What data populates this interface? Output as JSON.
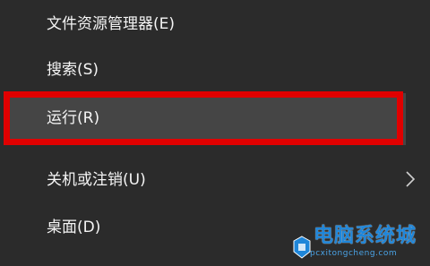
{
  "menu": {
    "items": [
      {
        "label": "文件资源管理器(E)"
      },
      {
        "label": "搜索(S)"
      },
      {
        "label": "运行(R)"
      },
      {
        "label": "关机或注销(U)"
      },
      {
        "label": "桌面(D)"
      }
    ]
  },
  "highlight": {
    "color": "#e00000"
  },
  "watermark": {
    "text_cn": "电脑系统城",
    "text_en": "pcxitongcheng.com"
  }
}
